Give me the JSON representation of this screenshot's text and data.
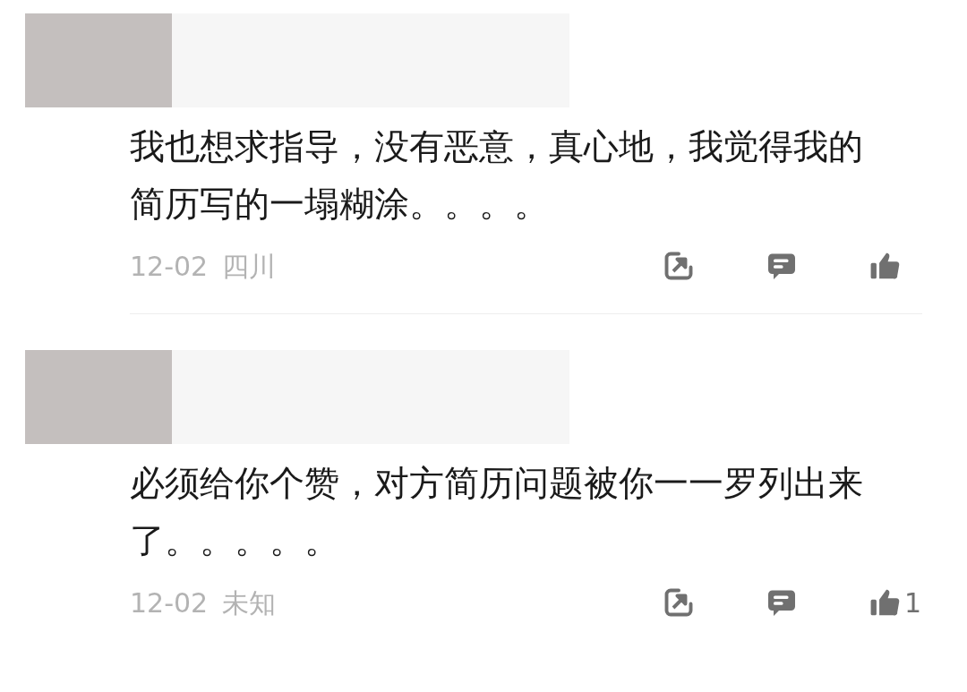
{
  "comments": [
    {
      "text": "我也想求指导，没有恶意，真心地，我觉得我的简历写的一塌糊涂。。。。",
      "date": "12-02",
      "location": "四川"
    },
    {
      "text": "必须给你个赞，对方简历问题被你一一罗列出来了。。。。。",
      "date": "12-02",
      "location": "未知",
      "likes": "1"
    }
  ]
}
